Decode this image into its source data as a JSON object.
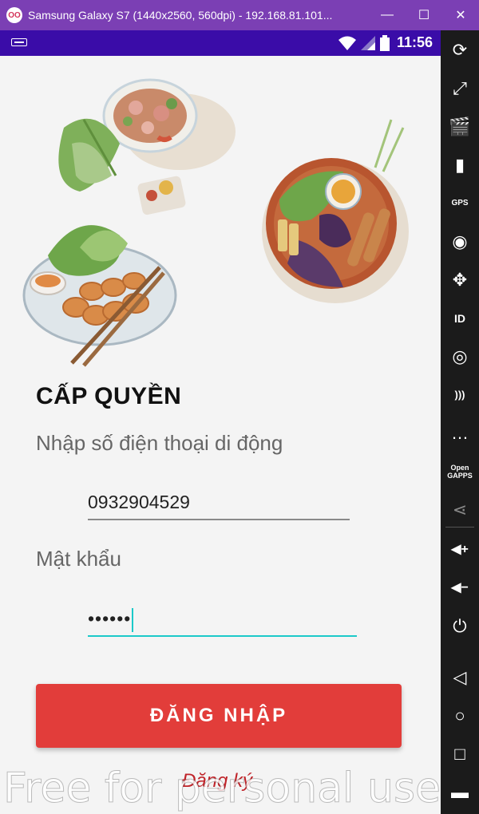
{
  "window": {
    "title": "Samsung Galaxy S7 (1440x2560, 560dpi) - 192.168.81.101...",
    "app_icon": "OO",
    "minimize": "—",
    "maximize": "☐",
    "close": "✕"
  },
  "statusbar": {
    "time": "11:56"
  },
  "login": {
    "heading": "CẤP QUYỀN",
    "phone_label": "Nhập số điện thoại di động",
    "phone_value": "0932904529",
    "password_label": "Mật khẩu",
    "password_value": "••••••",
    "login_button": "ĐĂNG NHẬP",
    "register_link": "Đăng ký"
  },
  "watermark": "Free for personal use",
  "sidebar": {
    "items": [
      {
        "icon": "rotate-icon",
        "glyph": "⟳"
      },
      {
        "icon": "fullscreen-icon",
        "glyph": "⤢"
      },
      {
        "icon": "screen-record-icon",
        "glyph": "🎬"
      },
      {
        "icon": "battery-icon",
        "glyph": "▮"
      },
      {
        "icon": "gps-icon",
        "glyph": "GPS"
      },
      {
        "icon": "camera-icon",
        "glyph": "◉"
      },
      {
        "icon": "move-icon",
        "glyph": "✥"
      },
      {
        "icon": "id-icon",
        "glyph": "ID"
      },
      {
        "icon": "disk-icon",
        "glyph": "◎"
      },
      {
        "icon": "rss-icon",
        "glyph": ")))"
      },
      {
        "icon": "sms-icon",
        "glyph": "…"
      },
      {
        "icon": "opengapps-icon",
        "glyph": "Open GAPPS"
      },
      {
        "icon": "share-icon",
        "glyph": "⋖"
      },
      {
        "icon": "volume-up-icon",
        "glyph": "◀+"
      },
      {
        "icon": "volume-down-icon",
        "glyph": "◀−"
      },
      {
        "icon": "power-icon",
        "glyph": "⏻"
      },
      {
        "icon": "back-icon",
        "glyph": "◁"
      },
      {
        "icon": "home-icon",
        "glyph": "○"
      },
      {
        "icon": "recents-icon",
        "glyph": "□"
      },
      {
        "icon": "menu-icon",
        "glyph": "▬"
      }
    ]
  },
  "colors": {
    "window_titlebar": "#7b3fb4",
    "statusbar": "#3a0ca8",
    "login_button": "#e23d3a",
    "register_link": "#c0242a",
    "focus_underline": "#1cc9c9"
  }
}
